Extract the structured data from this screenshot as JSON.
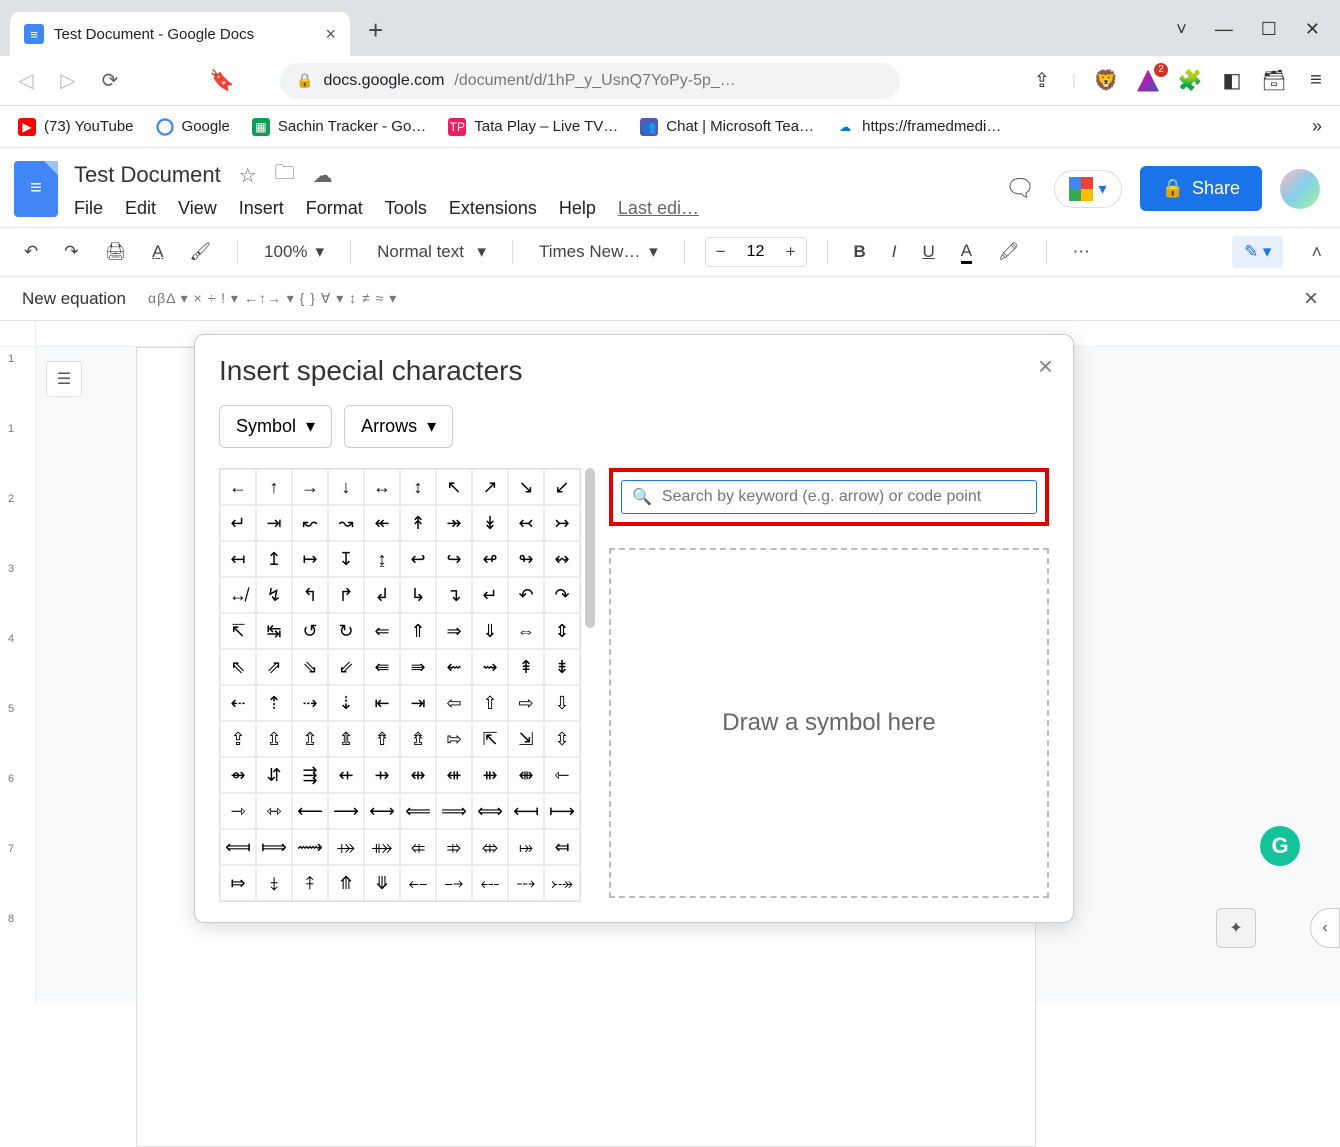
{
  "browser": {
    "tab_title": "Test Document - Google Docs",
    "url_host": "docs.google.com",
    "url_path": "/document/d/1hP_y_UsnQ7YoPy-5p_…",
    "badge": "2"
  },
  "bookmarks": {
    "yt": "(73) YouTube",
    "google": "Google",
    "sheet": "Sachin Tracker - Go…",
    "tata": "Tata Play – Live TV…",
    "teams": "Chat | Microsoft Tea…",
    "framed": "https://framedmedi…"
  },
  "docs": {
    "title": "Test Document",
    "menus": {
      "file": "File",
      "edit": "Edit",
      "view": "View",
      "insert": "Insert",
      "format": "Format",
      "tools": "Tools",
      "extensions": "Extensions",
      "help": "Help",
      "lastedit": "Last edi…"
    },
    "share": "Share",
    "toolbar": {
      "zoom": "100%",
      "style": "Normal text",
      "font": "Times New…",
      "size": "12"
    },
    "equation_label": "New equation",
    "equation_greek": "αβΔ ▾   × ÷ ! ▾   ←↑→ ▾   { } ∀ ▾   ↕ ≠ ≈ ▾"
  },
  "dialog": {
    "title": "Insert special characters",
    "cat1": "Symbol",
    "cat2": "Arrows",
    "search_placeholder": "Search by keyword (e.g. arrow) or code point",
    "draw_label": "Draw a symbol here",
    "chars": [
      "←",
      "↑",
      "→",
      "↓",
      "↔",
      "↕",
      "↖",
      "↗",
      "↘",
      "↙",
      "↵",
      "⇥",
      "↜",
      "↝",
      "↞",
      "↟",
      "↠",
      "↡",
      "↢",
      "↣",
      "↤",
      "↥",
      "↦",
      "↧",
      "↨",
      "↩",
      "↪",
      "↫",
      "↬",
      "↭",
      "↮",
      "↯",
      "↰",
      "↱",
      "↲",
      "↳",
      "↴",
      "↵",
      "↶",
      "↷",
      "↸",
      "↹",
      "↺",
      "↻",
      "⇐",
      "⇑",
      "⇒",
      "⇓",
      "⇔",
      "⇕",
      "⇖",
      "⇗",
      "⇘",
      "⇙",
      "⇚",
      "⇛",
      "⇜",
      "⇝",
      "⇞",
      "⇟",
      "⇠",
      "⇡",
      "⇢",
      "⇣",
      "⇤",
      "⇥",
      "⇦",
      "⇧",
      "⇨",
      "⇩",
      "⇪",
      "⇫",
      "⇬",
      "⇭",
      "⇮",
      "⇯",
      "⇰",
      "⇱",
      "⇲",
      "⇳",
      "⇴",
      "⇵",
      "⇶",
      "⇷",
      "⇸",
      "⇹",
      "⇺",
      "⇻",
      "⇼",
      "⇽",
      "⇾",
      "⇿",
      "⟵",
      "⟶",
      "⟷",
      "⟸",
      "⟹",
      "⟺",
      "⟻",
      "⟼",
      "⟽",
      "⟾",
      "⟿",
      "⤀",
      "⤁",
      "⤂",
      "⤃",
      "⤄",
      "⤅",
      "⤆",
      "⤇",
      "⤈",
      "⤉",
      "⤊",
      "⤋",
      "⤌",
      "⤍",
      "⤎",
      "⤏",
      "⤐"
    ]
  }
}
